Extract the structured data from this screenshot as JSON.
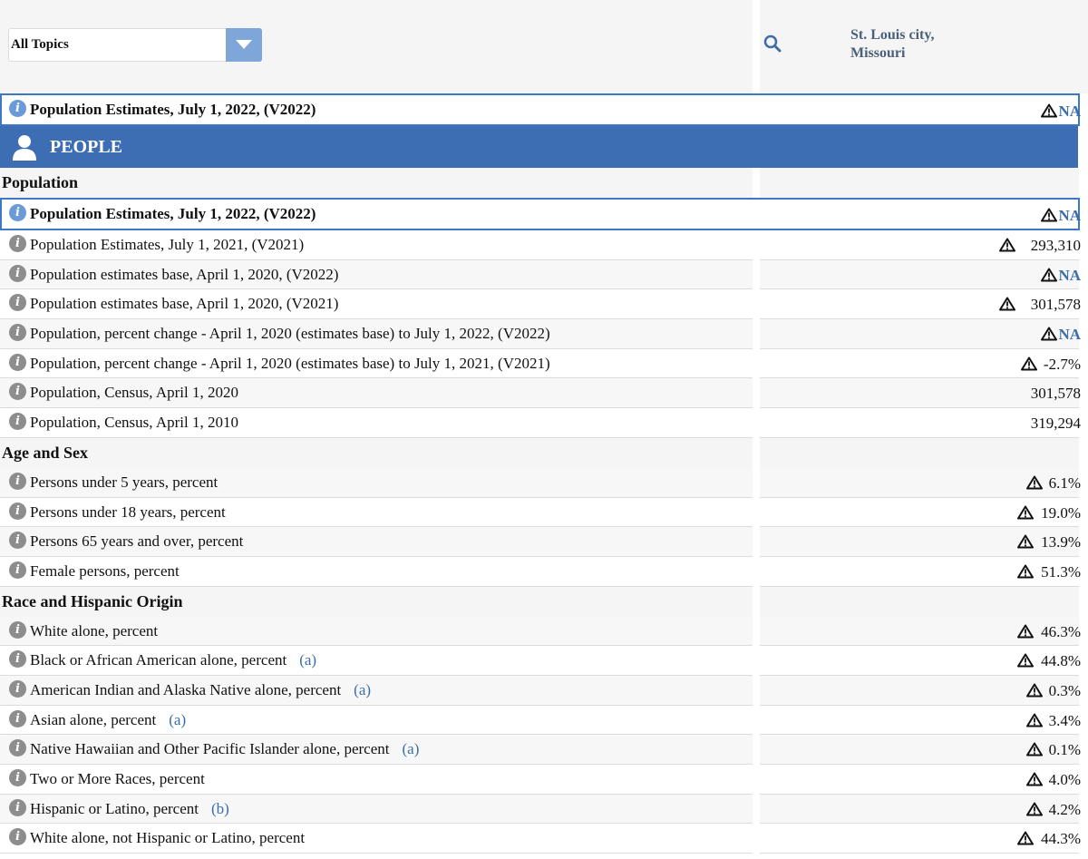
{
  "header": {
    "topic_select": "All Topics",
    "geography_line1": "St. Louis city,",
    "geography_line2": "Missouri"
  },
  "pinned": {
    "label": "Population Estimates, July 1, 2022, (V2022)",
    "value": "NA"
  },
  "people_title": "PEOPLE",
  "sections": {
    "population": {
      "title": "Population",
      "highlight": {
        "label": "Population Estimates, July 1, 2022, (V2022)",
        "value": "NA"
      },
      "rows": [
        {
          "label": "Population Estimates, July 1, 2021, (V2021)",
          "value": "293,310"
        },
        {
          "label": "Population estimates base, April 1, 2020, (V2022)",
          "value": "NA"
        },
        {
          "label": "Population estimates base, April 1, 2020, (V2021)",
          "value": "301,578"
        },
        {
          "label": "Population, percent change - April 1, 2020 (estimates base) to July 1, 2022, (V2022)",
          "value": "NA"
        },
        {
          "label": "Population, percent change - April 1, 2020 (estimates base) to July 1, 2021, (V2021)",
          "value": "-2.7%"
        },
        {
          "label": "Population, Census, April 1, 2020",
          "value": "301,578"
        },
        {
          "label": "Population, Census, April 1, 2010",
          "value": "319,294"
        }
      ]
    },
    "age_sex": {
      "title": "Age and Sex",
      "rows": [
        {
          "label": "Persons under 5 years, percent",
          "value": "6.1%"
        },
        {
          "label": "Persons under 18 years, percent",
          "value": "19.0%"
        },
        {
          "label": "Persons 65 years and over, percent",
          "value": "13.9%"
        },
        {
          "label": "Female persons, percent",
          "value": "51.3%"
        }
      ]
    },
    "race": {
      "title": "Race and Hispanic Origin",
      "rows": [
        {
          "label": "White alone, percent",
          "note": "",
          "value": "46.3%"
        },
        {
          "label": "Black or African American alone, percent",
          "note": "(a)",
          "value": "44.8%"
        },
        {
          "label": "American Indian and Alaska Native alone, percent",
          "note": "(a)",
          "value": "0.3%"
        },
        {
          "label": "Asian alone, percent",
          "note": "(a)",
          "value": "3.4%"
        },
        {
          "label": "Native Hawaiian and Other Pacific Islander alone, percent",
          "note": "(a)",
          "value": "0.1%"
        },
        {
          "label": "Two or More Races, percent",
          "note": "",
          "value": "4.0%"
        },
        {
          "label": "Hispanic or Latino, percent",
          "note": "(b)",
          "value": "4.2%"
        },
        {
          "label": "White alone, not Hispanic or Latino, percent",
          "note": "",
          "value": "44.3%"
        }
      ]
    }
  },
  "icons": {
    "info": "info-icon",
    "warning": "warning-triangle-icon",
    "search": "search-icon",
    "person": "person-icon",
    "dropdown": "chevron-down-icon"
  },
  "colors": {
    "accent": "#3d6eb4",
    "link": "#3a6ea8",
    "dropdown_button": "#7fa6d8"
  }
}
